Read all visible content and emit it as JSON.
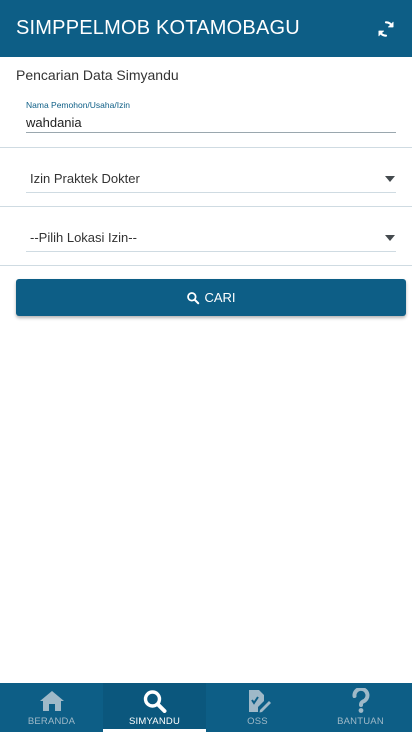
{
  "header": {
    "title": "SIMPPELMOB KOTAMOBAGU",
    "refresh_icon": "refresh-icon"
  },
  "search": {
    "section_title": "Pencarian Data Simyandu",
    "name_label": "Nama Pemohon/Usaha/Izin",
    "name_value": "wahdania",
    "permit_type_selected": "Izin Praktek Dokter",
    "location_selected": "--Pilih Lokasi Izin--",
    "button_label": "CARI"
  },
  "nav": {
    "items": [
      {
        "label": "BERANDA",
        "icon": "home-icon",
        "active": false
      },
      {
        "label": "SIMYANDU",
        "icon": "search-icon",
        "active": true
      },
      {
        "label": "OSS",
        "icon": "document-edit-icon",
        "active": false
      },
      {
        "label": "BANTUAN",
        "icon": "question-icon",
        "active": false
      }
    ]
  },
  "colors": {
    "primary": "#0d5e86",
    "inactive_nav": "#9fb9c8"
  }
}
